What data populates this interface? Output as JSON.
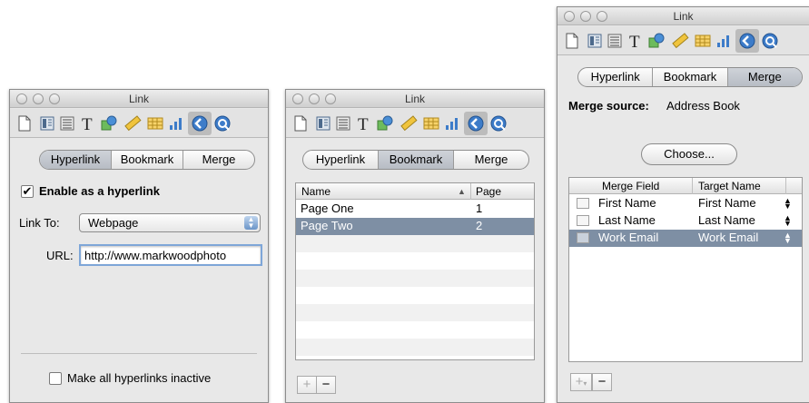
{
  "windows": {
    "hyperlink": {
      "title": "Link",
      "tabs": [
        "Hyperlink",
        "Bookmark",
        "Merge"
      ],
      "enable_label": "Enable as a hyperlink",
      "enable_checked": true,
      "link_to_label": "Link To:",
      "link_to_value": "Webpage",
      "url_label": "URL:",
      "url_value": "http://www.markwoodphoto",
      "inactive_label": "Make all hyperlinks inactive",
      "inactive_checked": false
    },
    "bookmark": {
      "title": "Link",
      "tabs": [
        "Hyperlink",
        "Bookmark",
        "Merge"
      ],
      "columns": [
        "Name",
        "Page"
      ],
      "sort_indicator": "▲",
      "rows": [
        {
          "name": "Page One",
          "page": "1"
        },
        {
          "name": "Page Two",
          "page": "2"
        }
      ],
      "add_label": "+",
      "remove_label": "−"
    },
    "merge": {
      "title": "Link",
      "tabs": [
        "Hyperlink",
        "Bookmark",
        "Merge"
      ],
      "source_label": "Merge source:",
      "source_value": "Address Book",
      "choose_label": "Choose...",
      "columns": [
        "Merge Field",
        "Target Name"
      ],
      "rows": [
        {
          "field": "First Name",
          "target": "First Name"
        },
        {
          "field": "Last Name",
          "target": "Last Name"
        },
        {
          "field": "Work Email",
          "target": "Work Email"
        }
      ],
      "add_label": "+",
      "add_menu_indicator": "▾",
      "remove_label": "−"
    }
  },
  "toolbar_icons": [
    "document-icon",
    "layout-icon",
    "wrap-icon",
    "text-icon",
    "shape-icon",
    "ruler-icon",
    "table-icon",
    "chart-icon",
    "link-icon",
    "quicktime-icon"
  ],
  "colors": {
    "selection": "#7e8fa4",
    "accent_blue": "#3d7cc9"
  }
}
